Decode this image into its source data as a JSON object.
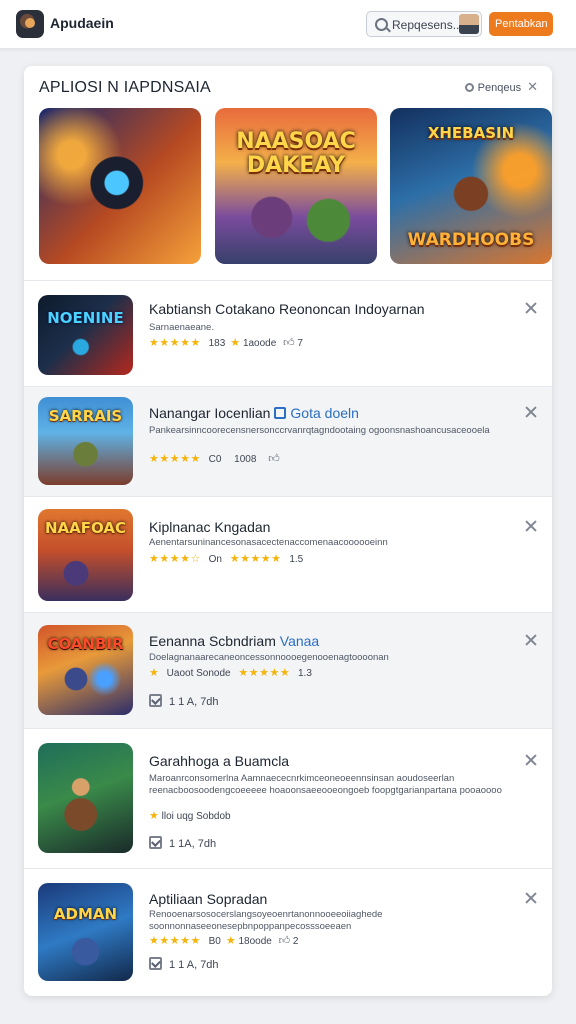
{
  "topbar": {
    "app_title": "Apudaein",
    "search_text": "Repqesens...",
    "button_label": "Pentabkan"
  },
  "panel": {
    "title": "APLIOSI N IAPDNSAIA",
    "filter_label": "Penqeus"
  },
  "featured": [
    {
      "word": ""
    },
    {
      "word": "NAASOAC DAKEAY"
    },
    {
      "word": "XHEBASIN"
    }
  ],
  "featured_bottom_3": "WARDHOOBS",
  "items": [
    {
      "name": "Kabtiansh Cotakano Reononcan Indoyarnan",
      "tag": "",
      "thumb_word": "NOENINE",
      "desc": "Sarnaenaeane.",
      "rating_count": "183",
      "downloads": "1aoode",
      "likes": "7",
      "stars": "★★★★★"
    },
    {
      "name": "Nanangar Iocenlian",
      "tag": "Gota doeln",
      "thumb_word": "SARRAIS",
      "desc": "Pankearsinncoorecensnersonccrvanrqtagndootaing ogoonsnashoancusaceooela",
      "rating_count": "C0",
      "downloads": "1008",
      "likes": "",
      "stars": "★★★★★"
    },
    {
      "name": "Kiplnanac Kngadan",
      "tag": "",
      "thumb_word": "NAAFOAC",
      "desc": "Aenentarsuninancesonasacectenaccomenaacoooooeinn",
      "rating_count": "On",
      "downloads": "1.5",
      "likes": "",
      "stars": "★★★★☆",
      "stars2": "★★★★★"
    },
    {
      "name": "Eenanna Scbndriam",
      "tag": "Vanaa",
      "thumb_word": "COANBIR",
      "desc": "Doelagnanaarecaneoncessonnoooegenooenagtoooonan",
      "rating_count": "Uaoot Sonode",
      "downloads": "1.3",
      "likes": "",
      "stars": "★★★★★",
      "check": "1 1 A, 7dh"
    },
    {
      "name": "Garahhoga a Buamcla",
      "tag": "",
      "thumb_word": "",
      "desc": "Maroanrconsomerlna Aamnaececnrkimceoneoeennsinsan aoudoseerlan reenacboosoodengcoeeeee hoaoonsaeeooeongoeb foopgtgarianpartana pooaoooo",
      "rating_count": "lloi uqg Sobdob",
      "downloads": "",
      "likes": "",
      "stars": "",
      "check": "1 1A, 7dh"
    },
    {
      "name": "Aptiliaan Sopradan",
      "tag": "",
      "thumb_word": "ADMAN",
      "desc": "Renooenarsosocerslangsoyeoenrtanonnooeeoiiaghede soonnonnaseeonesepbnpoppanpecosssoeeaen",
      "rating_count": "B0",
      "downloads": "18oode",
      "likes": "2",
      "stars": "★★★★★",
      "check": "1 1 A, 7dh"
    }
  ]
}
